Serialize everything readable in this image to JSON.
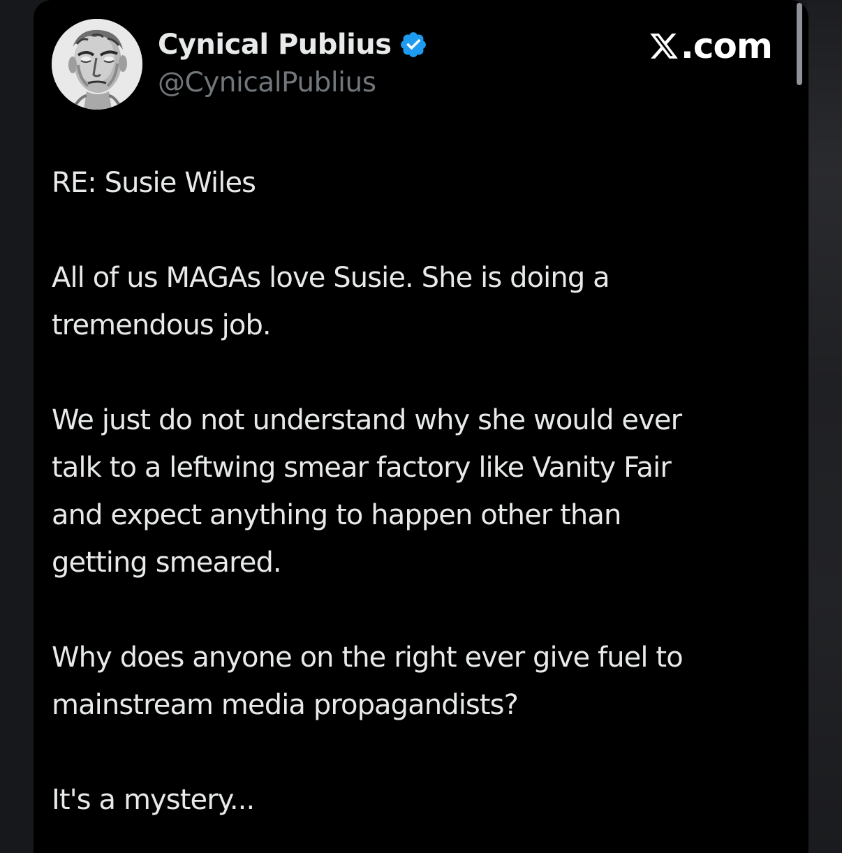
{
  "colors": {
    "card_background": "#000000",
    "primary_text": "#e7e9ea",
    "secondary_text": "#71767b",
    "verified_badge": "#1d9bf0"
  },
  "author": {
    "display_name": "Cynical Publius",
    "handle": "@CynicalPublius",
    "verified": true,
    "avatar_icon": "roman-bust-avatar"
  },
  "brand": {
    "icon": "x-logo-icon",
    "suffix": ".com"
  },
  "tweet": {
    "paragraphs": [
      [
        "RE: Susie Wiles"
      ],
      [
        "All of us MAGAs love Susie.  She is doing a",
        "tremendous job."
      ],
      [
        "We just do not understand why she would ever",
        "talk to a leftwing smear factory like Vanity Fair",
        "and expect anything to happen other than",
        "getting smeared."
      ],
      [
        "Why does anyone on the right ever give fuel to",
        "mainstream media propagandists?"
      ],
      [
        "It's a mystery..."
      ]
    ]
  }
}
